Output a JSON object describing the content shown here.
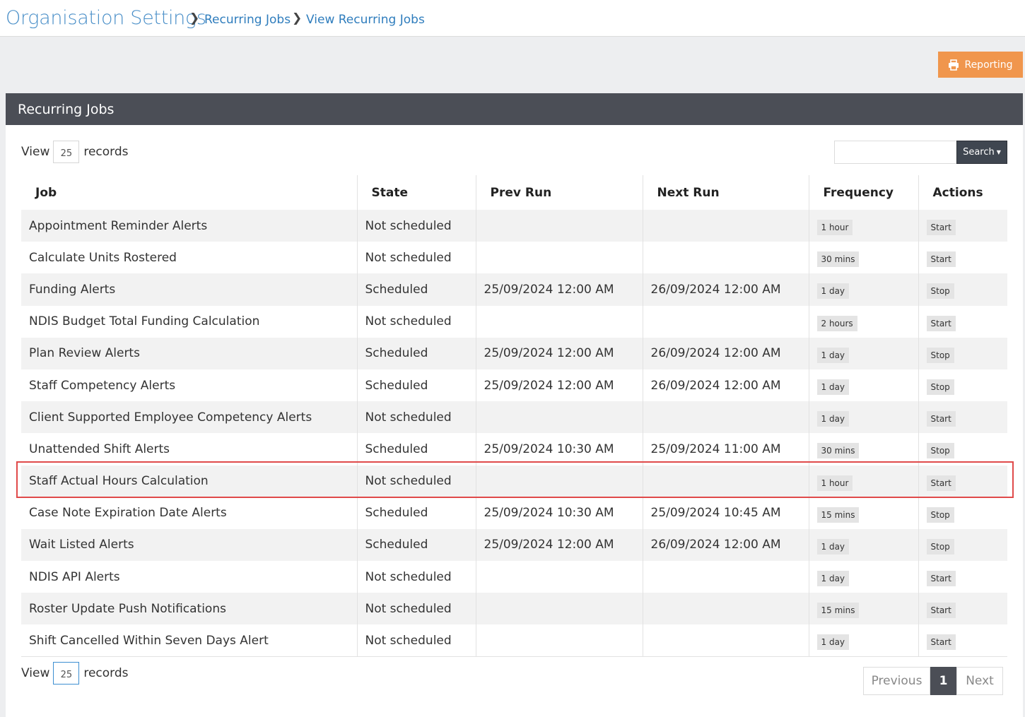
{
  "breadcrumb": {
    "title": "Organisation Settings",
    "items": [
      "Recurring Jobs",
      "View Recurring Jobs"
    ]
  },
  "toolbar": {
    "reporting_label": "Reporting"
  },
  "panel": {
    "title": "Recurring Jobs"
  },
  "length": {
    "prefix": "View",
    "value": "25",
    "suffix": "records"
  },
  "search": {
    "button_label": "Search"
  },
  "columns": [
    "Job",
    "State",
    "Prev Run",
    "Next Run",
    "Frequency",
    "Actions"
  ],
  "rows": [
    {
      "job": "Appointment Reminder Alerts",
      "state": "Not scheduled",
      "prev": "",
      "next": "",
      "freq": "1 hour",
      "action": "Start"
    },
    {
      "job": "Calculate Units Rostered",
      "state": "Not scheduled",
      "prev": "",
      "next": "",
      "freq": "30 mins",
      "action": "Start"
    },
    {
      "job": "Funding Alerts",
      "state": "Scheduled",
      "prev": "25/09/2024 12:00 AM",
      "next": "26/09/2024 12:00 AM",
      "freq": "1 day",
      "action": "Stop"
    },
    {
      "job": "NDIS Budget Total Funding Calculation",
      "state": "Not scheduled",
      "prev": "",
      "next": "",
      "freq": "2 hours",
      "action": "Start"
    },
    {
      "job": "Plan Review Alerts",
      "state": "Scheduled",
      "prev": "25/09/2024 12:00 AM",
      "next": "26/09/2024 12:00 AM",
      "freq": "1 day",
      "action": "Stop"
    },
    {
      "job": "Staff Competency Alerts",
      "state": "Scheduled",
      "prev": "25/09/2024 12:00 AM",
      "next": "26/09/2024 12:00 AM",
      "freq": "1 day",
      "action": "Stop"
    },
    {
      "job": "Client Supported Employee Competency Alerts",
      "state": "Not scheduled",
      "prev": "",
      "next": "",
      "freq": "1 day",
      "action": "Start"
    },
    {
      "job": "Unattended Shift Alerts",
      "state": "Scheduled",
      "prev": "25/09/2024 10:30 AM",
      "next": "25/09/2024 11:00 AM",
      "freq": "30 mins",
      "action": "Stop"
    },
    {
      "job": "Staff Actual Hours Calculation",
      "state": "Not scheduled",
      "prev": "",
      "next": "",
      "freq": "1 hour",
      "action": "Start"
    },
    {
      "job": "Case Note Expiration Date Alerts",
      "state": "Scheduled",
      "prev": "25/09/2024 10:30 AM",
      "next": "25/09/2024 10:45 AM",
      "freq": "15 mins",
      "action": "Stop"
    },
    {
      "job": "Wait Listed Alerts",
      "state": "Scheduled",
      "prev": "25/09/2024 12:00 AM",
      "next": "26/09/2024 12:00 AM",
      "freq": "1 day",
      "action": "Stop"
    },
    {
      "job": "NDIS API Alerts",
      "state": "Not scheduled",
      "prev": "",
      "next": "",
      "freq": "1 day",
      "action": "Start"
    },
    {
      "job": "Roster Update Push Notifications",
      "state": "Not scheduled",
      "prev": "",
      "next": "",
      "freq": "15 mins",
      "action": "Start"
    },
    {
      "job": "Shift Cancelled Within Seven Days Alert",
      "state": "Not scheduled",
      "prev": "",
      "next": "",
      "freq": "1 day",
      "action": "Start"
    }
  ],
  "pagination": {
    "previous": "Previous",
    "current": "1",
    "next": "Next"
  },
  "icons": {
    "reporting": "printer-icon",
    "search_caret": "caret-down-icon",
    "breadcrumb_sep": "chevron-right-icon"
  },
  "colors": {
    "accent": "#4a8fc8",
    "reporting": "#f0964d",
    "header": "#4b4e56",
    "highlight": "#e04a4a"
  }
}
